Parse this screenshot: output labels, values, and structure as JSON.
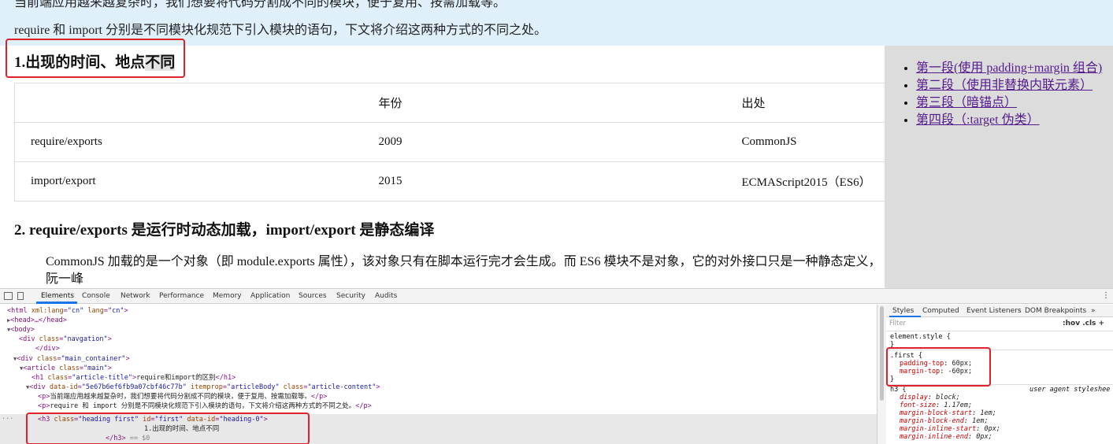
{
  "page": {
    "intro_line1": "当前端应用越来越复杂时，我们想要将代码分割成不同的模块，便于复用、按需加载等。",
    "intro_line2": "require 和 import 分别是不同模块化规范下引入模块的语句，下文将介绍这两种方式的不同之处。",
    "heading1_prefix": "1.出现的时间、地点",
    "heading1_highlight": "不同",
    "table": {
      "header": [
        "",
        "年份",
        "出处"
      ],
      "rows": [
        [
          "require/exports",
          "2009",
          "CommonJS"
        ],
        [
          "import/export",
          "2015",
          "ECMAScript2015（ES6）"
        ]
      ]
    },
    "heading2": "2. require/exports 是运行时动态加载，import/export 是静态编译",
    "paragraph_line1": "CommonJS 加载的是一个对象（即 module.exports 属性），该对象只有在脚本运行完才会生成。而 ES6 模块不是对象，它的对外接口只是一种静态定义，",
    "paragraph_line2": "阮一峰"
  },
  "sidebar": {
    "links": [
      "第一段(使用 padding+margin 组合)",
      "第二段（使用非替换内联元素）",
      "第三段（暗锚点）",
      "第四段（:target 伪类）"
    ]
  },
  "devtools": {
    "tabs": [
      "Elements",
      "Console",
      "Network",
      "Performance",
      "Memory",
      "Application",
      "Sources",
      "Security",
      "Audits"
    ],
    "active_tab": "Elements",
    "dom": {
      "l1_tag": "<html",
      "l1_a1": " xml:lang",
      "l1_v1": "\"cn\"",
      "l1_a2": " lang",
      "l1_v2": "\"cn\"",
      "l1_end": ">",
      "l2": "<head>…</head>",
      "l3": "<body>",
      "l4_tag": "<div",
      "l4_a": " class",
      "l4_v": "\"navgation\"",
      "l4_end": ">",
      "l5": "</div>",
      "l6_tag": "<div",
      "l6_a": " class",
      "l6_v": "\"main_container\"",
      "l6_end": ">",
      "l7_tag": "<article",
      "l7_a": " class",
      "l7_v": "\"main\"",
      "l7_end": ">",
      "l8_tag": "<h1",
      "l8_a": " class",
      "l8_v": "\"article-title\"",
      "l8_mid": ">",
      "l8_text": "require和import的区别",
      "l8_end": "</h1>",
      "l9_tag": "<div",
      "l9_a1": " data-id",
      "l9_v1": "\"5e67b6ef6fb9a07cbf46c77b\"",
      "l9_a2": " itemprop",
      "l9_v2": "\"articleBody\"",
      "l9_a3": " class",
      "l9_v3": "\"article-content\"",
      "l9_end": ">",
      "l10_tag": "<p>",
      "l10_text": "当前端应用越来越复杂时，我们想要将代码分割成不同的模块，便于复用、按需加载等。",
      "l10_end": "</p>",
      "l11_tag": "<p>",
      "l11_text": "require 和 import 分别是不同模块化规范下引入模块的语句，下文将介绍这两种方式的不同之处。",
      "l11_end": "</p>",
      "l12_prefix": "...",
      "l12_tag": "<h3",
      "l12_a1": " class",
      "l12_v1": "\"heading first\"",
      "l12_a2": " id",
      "l12_v2": "\"first\"",
      "l12_a3": " data-id",
      "l12_v3": "\"heading-0\"",
      "l12_end": ">",
      "l13_text": "1.出现的时间、地点不同",
      "l14_tag": "</h3>",
      "l14_eq": " == $0"
    },
    "styles": {
      "tabs": [
        "Styles",
        "Computed",
        "Event Listeners",
        "DOM Breakpoints",
        "»"
      ],
      "filter_placeholder": "Filter",
      "filter_buttons": ":hov  .cls  +",
      "element_style": "element.style {",
      "close": "}",
      "first_selector": ".first {",
      "first_props": [
        {
          "name": "padding-top",
          "value": "60px;"
        },
        {
          "name": "margin-top",
          "value": "-60px;"
        }
      ],
      "ua_selector": "h3 {",
      "ua_label": "user agent styleshee",
      "ua_props": [
        {
          "name": "display",
          "value": "block;"
        },
        {
          "name": "font-size",
          "value": "1.17em;"
        },
        {
          "name": "margin-block-start",
          "value": "1em;"
        },
        {
          "name": "margin-block-end",
          "value": "1em;"
        },
        {
          "name": "margin-inline-start",
          "value": "0px;"
        },
        {
          "name": "margin-inline-end",
          "value": "0px;"
        }
      ]
    }
  },
  "colors": {
    "highlight_box": "#e0202a",
    "intro_background": "#dff0fb",
    "sidebar_background": "#dcdcdc",
    "link": "#551a8b",
    "tab_accent": "#1a73e8"
  }
}
